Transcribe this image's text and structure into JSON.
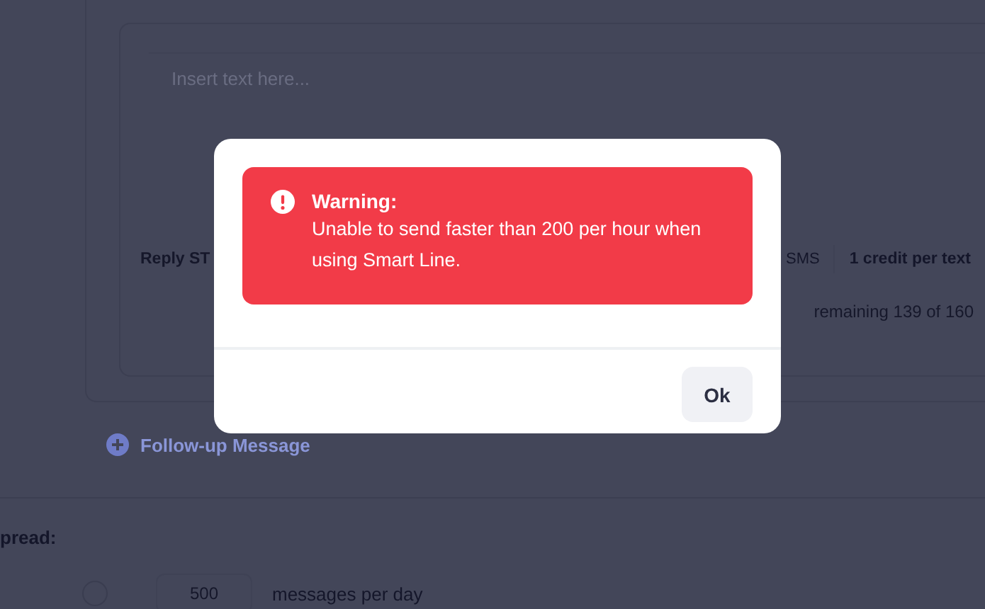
{
  "background": {
    "message_field": {
      "placeholder": "Insert text here..."
    },
    "reply_label": "Reply ST",
    "channel": "SMS",
    "cost": "1 credit per text",
    "remaining": "remaining 139 of 160",
    "follow_up": "Follow-up Message",
    "spread_label": "pread:",
    "rate": {
      "selected": false,
      "value": "500",
      "unit": "messages per day"
    }
  },
  "dialog": {
    "alert": {
      "kind": "warning",
      "title": "Warning:",
      "message": "Unable to send faster than 200 per hour when using Smart Line."
    },
    "buttons": [
      "Ok"
    ]
  }
}
